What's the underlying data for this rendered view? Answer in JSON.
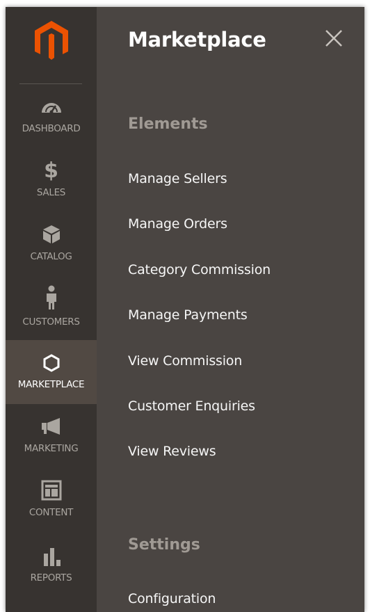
{
  "sidebar": {
    "logo_icon": "magento-logo-icon",
    "brand_color": "#eb5202",
    "items": [
      {
        "label": "DASHBOARD",
        "icon": "speedometer-icon"
      },
      {
        "label": "SALES",
        "icon": "dollar-icon"
      },
      {
        "label": "CATALOG",
        "icon": "box-icon"
      },
      {
        "label": "CUSTOMERS",
        "icon": "person-icon"
      },
      {
        "label": "MARKETPLACE",
        "icon": "hexagon-icon",
        "active": true
      },
      {
        "label": "MARKETING",
        "icon": "megaphone-icon"
      },
      {
        "label": "CONTENT",
        "icon": "layout-icon"
      },
      {
        "label": "REPORTS",
        "icon": "bar-chart-icon"
      }
    ]
  },
  "panel": {
    "title": "Marketplace",
    "close_icon": "close-icon",
    "sections": [
      {
        "title": "Elements",
        "links": [
          "Manage Sellers",
          "Manage Orders",
          "Category Commission",
          "Manage Payments",
          "View Commission",
          "Customer Enquiries",
          "View Reviews"
        ]
      },
      {
        "title": "Settings",
        "links": [
          "Configuration"
        ]
      }
    ]
  }
}
